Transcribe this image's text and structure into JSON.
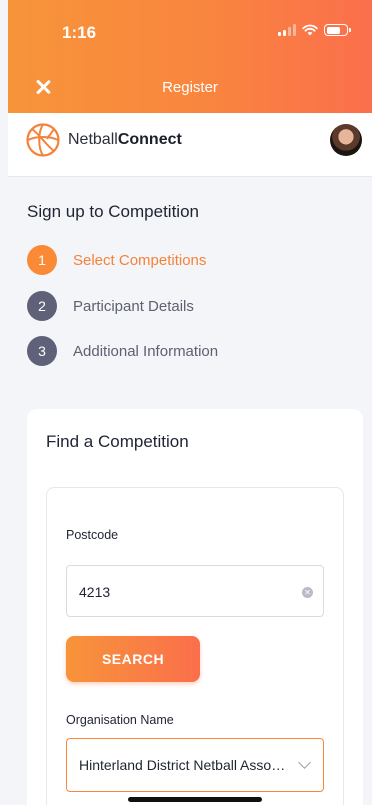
{
  "status": {
    "time": "1:16"
  },
  "header": {
    "title": "Register"
  },
  "brand": {
    "name_regular": "Netball",
    "name_bold": "Connect"
  },
  "page": {
    "title": "Sign up to Competition"
  },
  "steps": [
    {
      "number": "1",
      "label": "Select Competitions",
      "active": true
    },
    {
      "number": "2",
      "label": "Participant Details",
      "active": false
    },
    {
      "number": "3",
      "label": "Additional Information",
      "active": false
    }
  ],
  "find": {
    "title": "Find a Competition",
    "postcode_label": "Postcode",
    "postcode_value": "4213",
    "search_label": "SEARCH",
    "org_label": "Organisation Name",
    "org_value": "Hinterland District Netball Association"
  },
  "colors": {
    "accent": "#F7943A",
    "accent_end": "#FB6F4C",
    "step_inactive": "#5E6178"
  }
}
